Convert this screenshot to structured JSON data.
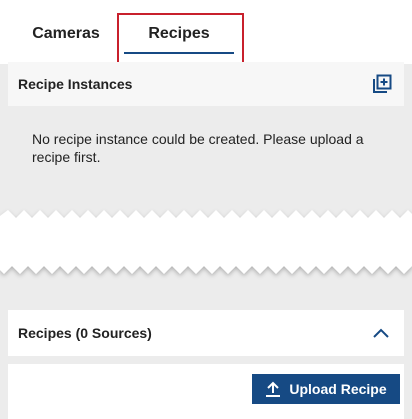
{
  "tabs": [
    {
      "label": "Cameras",
      "active": false
    },
    {
      "label": "Recipes",
      "active": true
    }
  ],
  "instances_panel": {
    "title": "Recipe Instances",
    "add_icon": "add-copy-icon",
    "empty_message": "No recipe instance could be created. Please upload a recipe first."
  },
  "recipes_panel": {
    "title": "Recipes (0 Sources)",
    "toggle_icon": "chevron-up-icon",
    "upload_label": "Upload Recipe",
    "upload_icon": "upload-icon"
  },
  "colors": {
    "accent": "#164a84",
    "highlight": "#c8202c",
    "background": "#ececec"
  }
}
